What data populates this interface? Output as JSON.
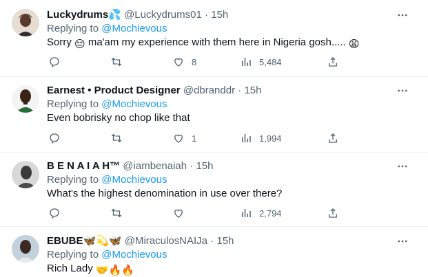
{
  "tweets": [
    {
      "name": "Luckydrums",
      "name_emoji": "💦",
      "handle": "@Luckydrums01",
      "time": "15h",
      "replying_to": "Replying to",
      "mention": "@Mochievous",
      "text_parts": [
        "Sorry ",
        "😔",
        " ma'am my experience with them here in Nigeria gosh..... ",
        "😩"
      ],
      "replies": "",
      "retweets": "",
      "likes": "8",
      "views": "5,484",
      "avatar_colors": [
        "#d9cfc5",
        "#3a2a22"
      ]
    },
    {
      "name": "Earnest • Product Designer",
      "handle": "@dbranddr",
      "time": "15h",
      "replying_to": "Replying to",
      "mention": "@Mochievous",
      "text": "Even bobrisky no chop like that",
      "replies": "",
      "retweets": "",
      "likes": "1",
      "views": "1,994",
      "avatar_colors": [
        "#f2f2f2",
        "#2b1e16"
      ]
    },
    {
      "name": "B E N A I A H™",
      "handle": "@iambenaiah",
      "time": "15h",
      "replying_to": "Replying to",
      "mention": "@Mochievous",
      "text": "What's the highest denomination in use over there?",
      "replies": "",
      "retweets": "",
      "likes": "",
      "views": "2,794",
      "avatar_colors": [
        "#cfcfcf",
        "#2e2e2e"
      ]
    },
    {
      "name": "EBUBE",
      "name_emojis": [
        "🦋",
        "💫",
        "🦋"
      ],
      "handle": "@MiraculosNAIJa",
      "time": "15h",
      "replying_to": "Replying to",
      "mention": "@Mochievous",
      "text_parts": [
        "Rich Lady ",
        "🤝",
        "🔥",
        "🔥"
      ],
      "avatar_colors": [
        "#b9c9d6",
        "#3a2a22"
      ]
    }
  ],
  "separator": "·",
  "icons": [
    "more-icon",
    "reply-icon",
    "retweet-icon",
    "like-icon",
    "views-icon",
    "share-icon"
  ]
}
